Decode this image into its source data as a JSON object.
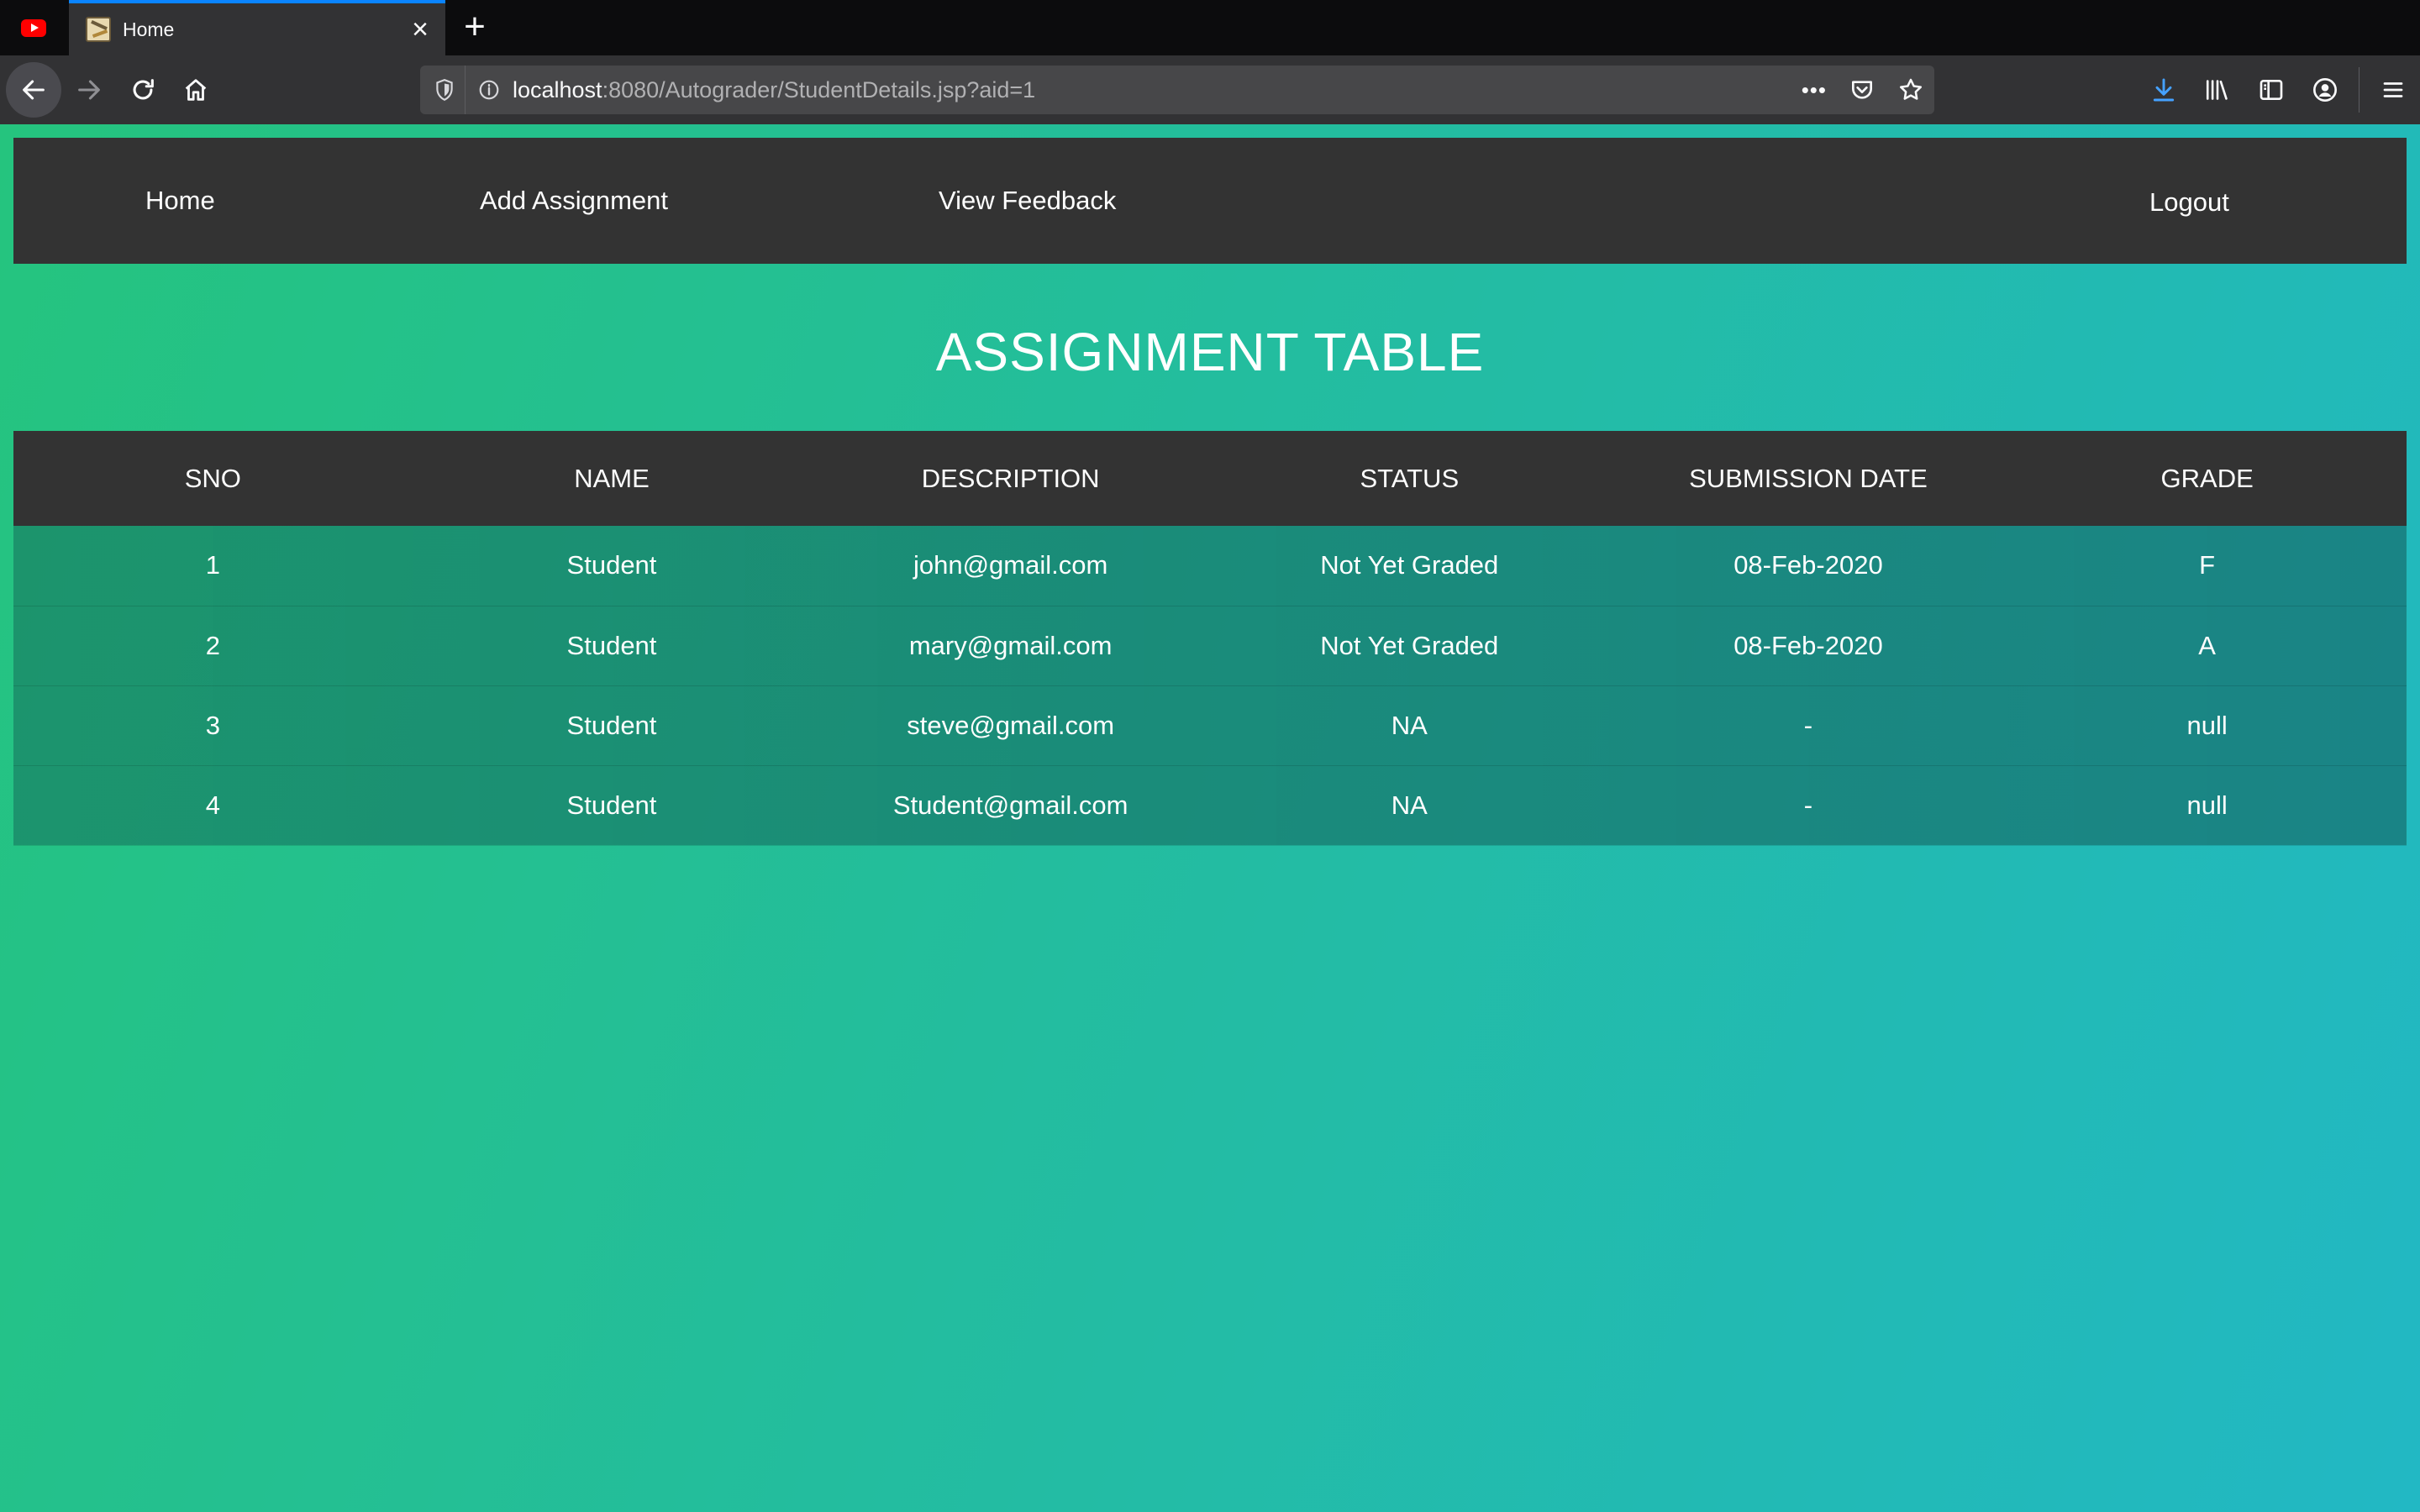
{
  "browser": {
    "tab_title": "Home",
    "url_host": "localhost",
    "url_rest": ":8080/Autograder/StudentDetails.jsp?aid=1",
    "page_actions": "•••"
  },
  "site": {
    "nav": {
      "home": "Home",
      "add_assignment": "Add Assignment",
      "view_feedback": "View Feedback",
      "logout": "Logout"
    },
    "title": "ASSIGNMENT TABLE"
  },
  "table": {
    "headers": [
      "SNO",
      "NAME",
      "DESCRIPTION",
      "STATUS",
      "SUBMISSION DATE",
      "GRADE"
    ],
    "rows": [
      [
        "1",
        "Student",
        "john@gmail.com",
        "Not Yet Graded",
        "08-Feb-2020",
        "F"
      ],
      [
        "2",
        "Student",
        "mary@gmail.com",
        "Not Yet Graded",
        "08-Feb-2020",
        "A"
      ],
      [
        "3",
        "Student",
        "steve@gmail.com",
        "NA",
        "-",
        "null"
      ],
      [
        "4",
        "Student",
        "Student@gmail.com",
        "NA",
        "-",
        "null"
      ]
    ]
  },
  "colors": {
    "gradient_start": "#25c47e",
    "gradient_end": "#22b8c4",
    "nav_bg": "#333333",
    "browser_accent": "#0a84ff"
  }
}
